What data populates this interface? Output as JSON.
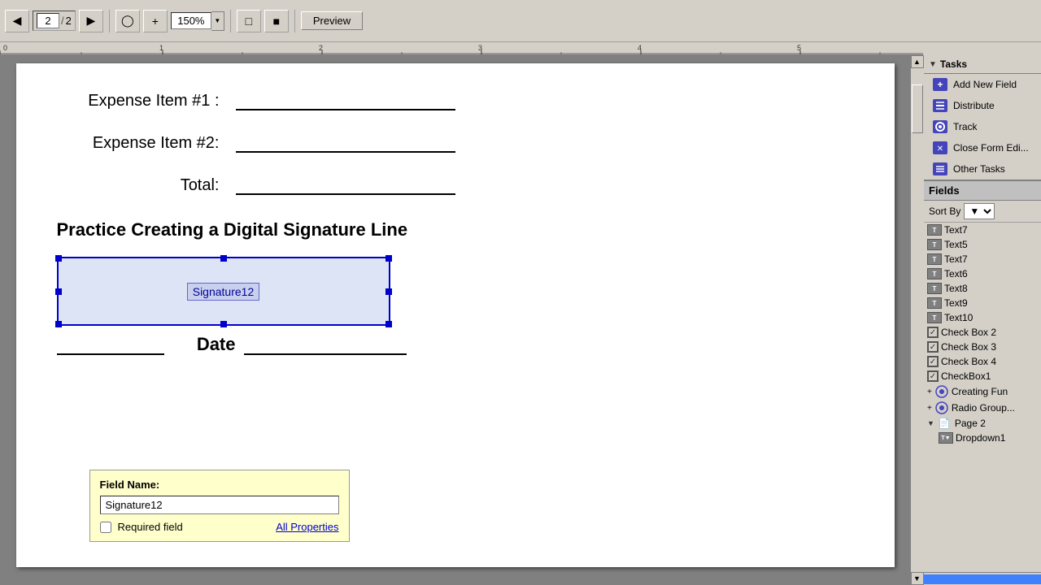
{
  "toolbar": {
    "page_current": "2",
    "page_total": "2",
    "zoom_value": "150%",
    "preview_label": "Preview"
  },
  "ruler": {
    "marks": [
      0,
      1,
      2,
      3,
      4,
      5
    ]
  },
  "document": {
    "expense1_label": "Expense Item #1 :",
    "expense2_label": "Expense Item #2:",
    "total_label": "Total:",
    "section_title": "Practice Creating a Digital Signature Line",
    "signature_field_name": "Signature12",
    "date_label": "Date"
  },
  "popup": {
    "title": "Field Name:",
    "field_value": "Signature12",
    "required_label": "Required field",
    "all_properties_label": "All Properties"
  },
  "tasks_panel": {
    "header": "Tasks",
    "items": [
      {
        "label": "Add New Field",
        "icon": "add-icon"
      },
      {
        "label": "Distribute",
        "icon": "distribute-icon"
      },
      {
        "label": "Track",
        "icon": "track-icon"
      },
      {
        "label": "Close Form Edi...",
        "icon": "close-form-icon"
      },
      {
        "label": "Other Tasks",
        "icon": "other-tasks-icon"
      }
    ]
  },
  "fields_panel": {
    "header": "Fields",
    "sort_by_label": "Sort By",
    "fields": [
      {
        "type": "text",
        "name": "Text7"
      },
      {
        "type": "text",
        "name": "Text5"
      },
      {
        "type": "text",
        "name": "Text7"
      },
      {
        "type": "text",
        "name": "Text6"
      },
      {
        "type": "text",
        "name": "Text8"
      },
      {
        "type": "text",
        "name": "Text9"
      },
      {
        "type": "text",
        "name": "Text10"
      },
      {
        "type": "check",
        "name": "Check Box 2",
        "checked": true
      },
      {
        "type": "check",
        "name": "Check Box 3",
        "checked": true
      },
      {
        "type": "check",
        "name": "Check Box 4",
        "checked": true
      },
      {
        "type": "check",
        "name": "CheckBox1",
        "checked": true
      },
      {
        "type": "group",
        "name": "Creating Fun"
      },
      {
        "type": "group",
        "name": "Radio Group..."
      }
    ],
    "page2": "Page 2",
    "page2_items": [
      {
        "type": "text",
        "name": "Dropdown1"
      }
    ]
  }
}
